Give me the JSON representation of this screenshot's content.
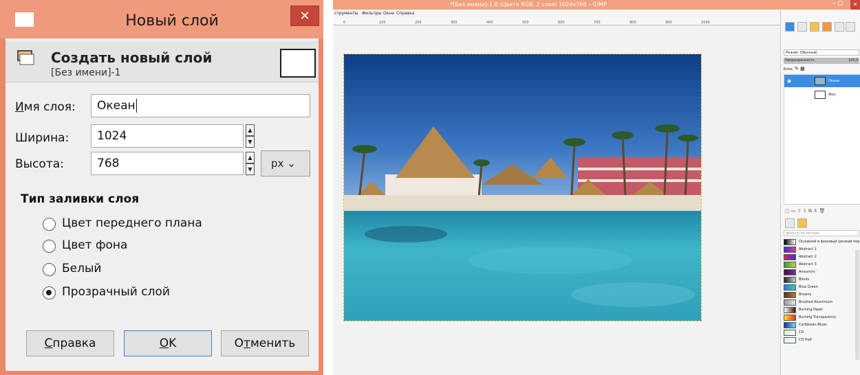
{
  "dialog": {
    "title": "Новый слой",
    "close_glyph": "✕",
    "header_title": "Создать новый слой",
    "header_subtitle": "[Без имени]-1",
    "name_label_first": "И",
    "name_label_rest": "мя слоя:",
    "name_value": "Океан",
    "width_label": "Ширина:",
    "width_value": "1024",
    "height_label": "Высота:",
    "height_value": "768",
    "unit_value": "px",
    "unit_arrow": "⌄",
    "fill_section": "Тип заливки слоя",
    "fill_options": [
      {
        "label": "Цвет переднего плана"
      },
      {
        "label": "Цвет фона"
      },
      {
        "label": "Белый"
      },
      {
        "label": "Прозрачный слой",
        "selected": true
      }
    ],
    "help_first": "С",
    "help_rest": "правка",
    "ok_first": "O",
    "ok_rest": "K",
    "cancel_a": "О",
    "cancel_u": "т",
    "cancel_b": "менить"
  },
  "gimp": {
    "title": "*[Без имени]-1.0 (Цвета RGB, 2 слоя) 1024x768 – GIMP",
    "minmax": "–  ◻",
    "close_glyph": "✕",
    "menu": [
      "струменты",
      "Фильтры",
      "Окна",
      "Справка"
    ],
    "mode_label": "Режим: Обычный",
    "opacity_label": "Непрозрачность",
    "opacity_value": "100,0",
    "lock_label": "Блок:",
    "layers": [
      {
        "name": "Океан",
        "selected": true
      },
      {
        "name": "Фон",
        "selected": false
      }
    ],
    "filter_placeholder": "фильтр по меткам",
    "gradients": [
      {
        "name": "Основной в фоновый (резкий пер",
        "colors": [
          "#000000",
          "#ffffff"
        ]
      },
      {
        "name": "Abstract 1",
        "colors": [
          "#3b2fd1",
          "#e03a8e"
        ]
      },
      {
        "name": "Abstract 2",
        "colors": [
          "#d12660",
          "#4b2cd6"
        ]
      },
      {
        "name": "Abstract 3",
        "colors": [
          "#2f9a3b",
          "#c7d83b"
        ]
      },
      {
        "name": "Aneurism",
        "colors": [
          "#3a0e4f",
          "#7e2ea0"
        ]
      },
      {
        "name": "Blinds",
        "colors": [
          "#222222",
          "#cccccc"
        ]
      },
      {
        "name": "Blue Green",
        "colors": [
          "#2a7de0",
          "#35d0b8"
        ]
      },
      {
        "name": "Browns",
        "colors": [
          "#5a3412",
          "#b27a3a"
        ]
      },
      {
        "name": "Brushed Aluminium",
        "colors": [
          "#9a9a9a",
          "#e8e8e8"
        ]
      },
      {
        "name": "Burning Paper",
        "colors": [
          "#ffffff",
          "#3a1a08"
        ]
      },
      {
        "name": "Burning Transparency",
        "colors": [
          "#ffe03a",
          "#e23a10"
        ]
      },
      {
        "name": "Caribbean Blues",
        "colors": [
          "#0a3a8a",
          "#7fd8f0"
        ]
      },
      {
        "name": "CD",
        "colors": [
          "#c9f1c9",
          "#ffffff"
        ]
      },
      {
        "name": "CD Half",
        "colors": [
          "#d8f6d8",
          "#ffffff"
        ]
      }
    ],
    "ruler_ticks": [
      "0",
      "100",
      "200",
      "300",
      "400",
      "500",
      "600",
      "700",
      "800",
      "900",
      "1000"
    ]
  }
}
